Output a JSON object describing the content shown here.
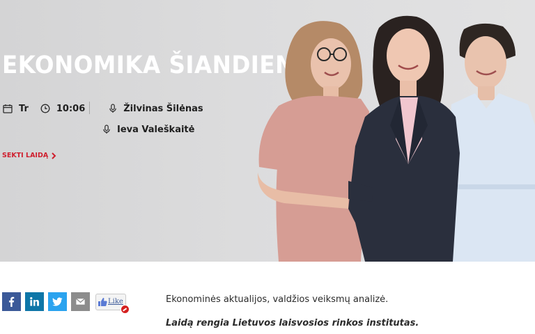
{
  "show": {
    "title": "EKONOMIKA ŠIANDIEN",
    "day": "Tr",
    "time": "10:06",
    "hosts": [
      "Žilvinas Šilėnas",
      "Ieva Valeškaitė"
    ],
    "follow_label": "SEKTI LAIDĄ",
    "follow_icon": "chevron-right-icon",
    "accent_color": "#cf1f2e"
  },
  "share": {
    "buttons": [
      {
        "name": "facebook",
        "icon": "facebook-icon",
        "color": "#3b5998"
      },
      {
        "name": "linkedin",
        "icon": "linkedin-icon",
        "color": "#0e76a8"
      },
      {
        "name": "twitter",
        "icon": "twitter-icon",
        "color": "#2aa3ef"
      },
      {
        "name": "email",
        "icon": "mail-icon",
        "color": "#8c8c8c"
      }
    ],
    "like_label": "Like"
  },
  "description": "Ekonominės aktualijos, valdžios veiksmų analizė.",
  "organizer": "Laidą rengia Lietuvos laisvosios rinkos institutas."
}
